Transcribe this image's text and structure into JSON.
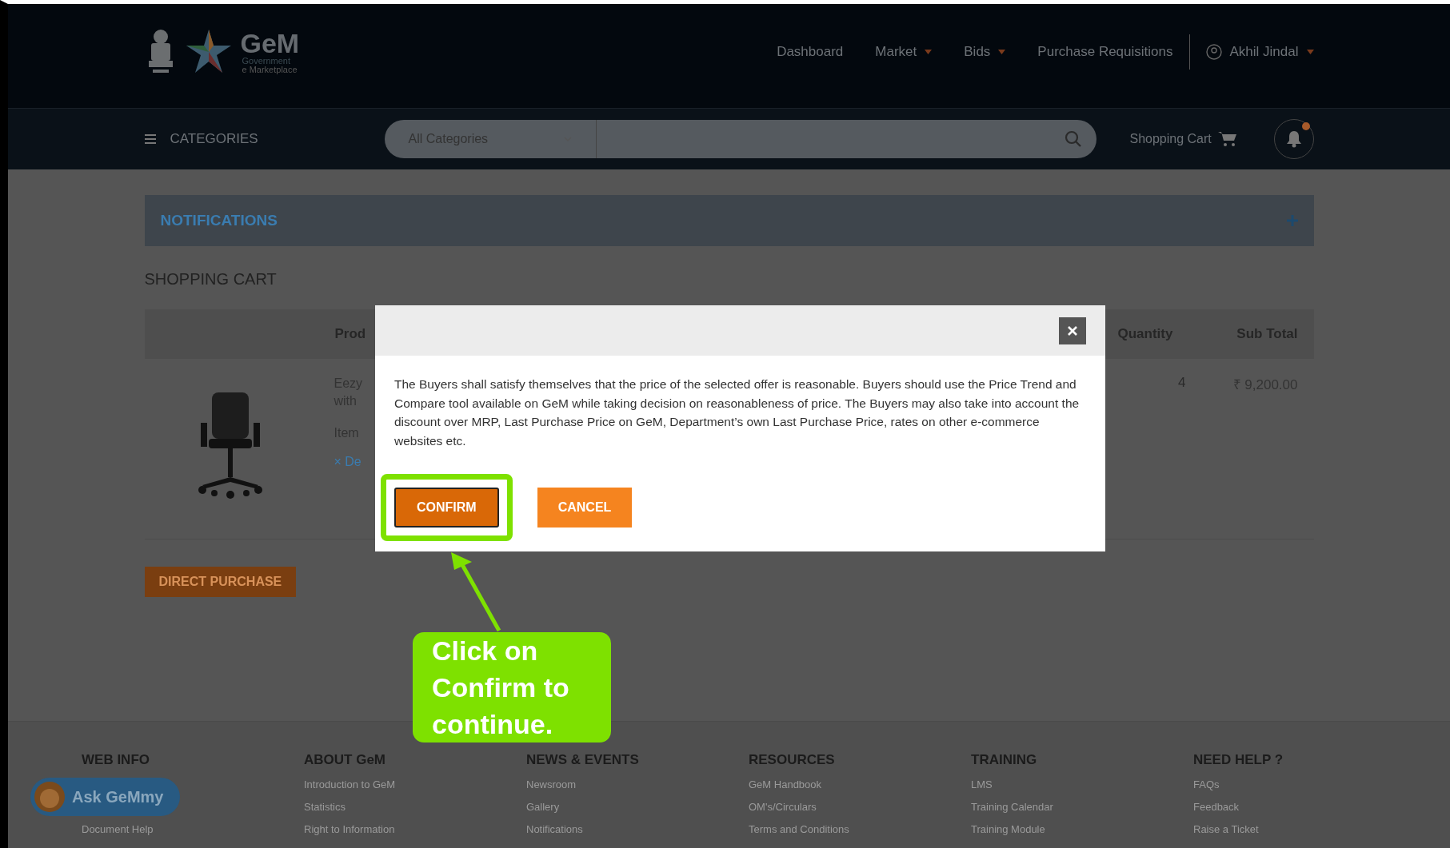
{
  "header": {
    "logo": {
      "name": "GeM",
      "line1": "Government",
      "line2": "e Marketplace"
    },
    "nav": [
      {
        "label": "Dashboard",
        "dropdown": false
      },
      {
        "label": "Market",
        "dropdown": true
      },
      {
        "label": "Bids",
        "dropdown": true
      },
      {
        "label": "Purchase Requisitions",
        "dropdown": false
      }
    ],
    "user": {
      "name": "Akhil Jindal",
      "dropdown": true
    }
  },
  "search_bar": {
    "categories": "CATEGORIES",
    "category_select": "All Categories",
    "cart": "Shopping Cart",
    "has_unread": true
  },
  "notifications": {
    "title": "NOTIFICATIONS",
    "expanded": false
  },
  "cart": {
    "title": "SHOPPING CART",
    "columns": [
      "Prod",
      "Quantity",
      "Sub Total"
    ],
    "item": {
      "name_lines": [
        "Eezy",
        "with"
      ],
      "item_label": "Item",
      "remove_icon": "×",
      "remove": "De",
      "quantity": "4",
      "subtotal": "₹ 9,200.00"
    },
    "direct_purchase": "DIRECT PURCHASE"
  },
  "modal": {
    "message": "The Buyers shall satisfy themselves that the price of the selected offer is reasonable. Buyers should use the Price Trend and Compare tool available on GeM while taking decision on reasonableness of price. The Buyers may also take into account the discount over MRP, Last Purchase Price on GeM, Department’s own Last Purchase Price, rates on other e-commerce websites etc.",
    "buttons": [
      {
        "label": "CONFIRM",
        "kind": "primary",
        "highlighted": true
      },
      {
        "label": "CANCEL",
        "kind": "secondary",
        "highlighted": false
      }
    ]
  },
  "callout": "Click on Confirm to continue.",
  "footer": {
    "chat": "Ask GeMmy",
    "columns": [
      {
        "heading": "WEB INFO",
        "links": [
          "Document Help"
        ]
      },
      {
        "heading": "ABOUT GeM",
        "links": [
          "Introduction to GeM",
          "Statistics",
          "Right to Information"
        ]
      },
      {
        "heading": "NEWS & EVENTS",
        "links": [
          "Newsroom",
          "Gallery",
          "Notifications"
        ]
      },
      {
        "heading": "RESOURCES",
        "links": [
          "GeM Handbook",
          "OM's/Circulars",
          "Terms and Conditions"
        ]
      },
      {
        "heading": "TRAINING",
        "links": [
          "LMS",
          "Training Calendar",
          "Training Module"
        ]
      },
      {
        "heading": "NEED HELP ?",
        "links": [
          "FAQs",
          "Feedback",
          "Raise a Ticket"
        ]
      }
    ]
  }
}
